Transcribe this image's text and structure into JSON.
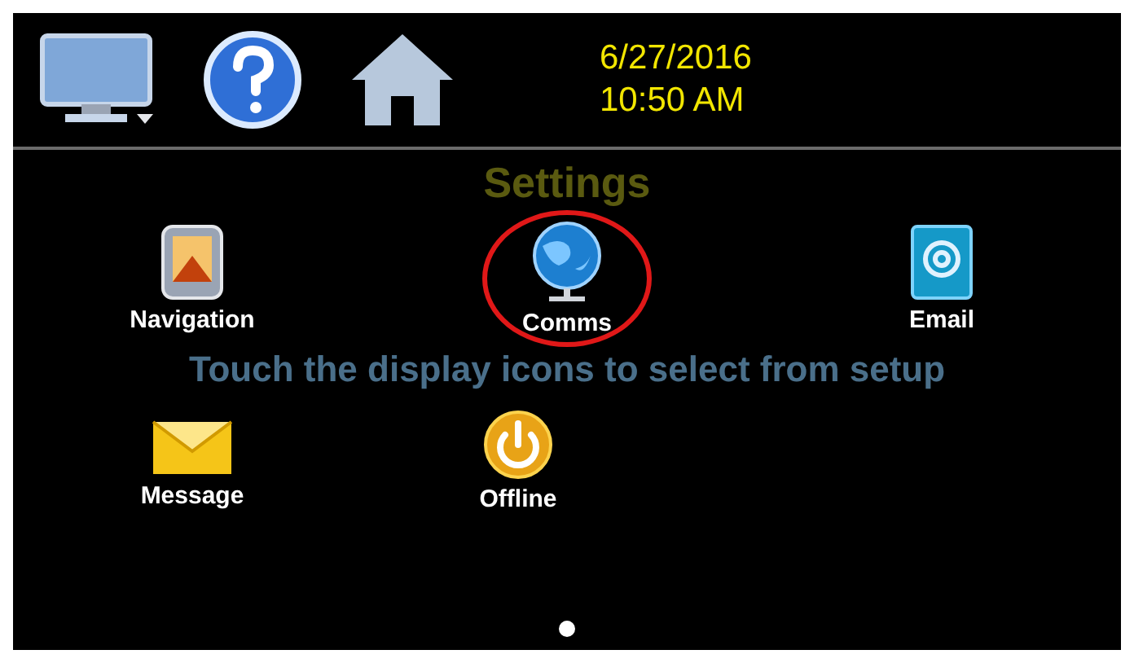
{
  "top_bar": {
    "date": "6/27/2016",
    "time": "10:50 AM"
  },
  "title": "Settings",
  "instruction": "Touch the display icons to select from setup",
  "rows": [
    [
      {
        "kind": "navigation",
        "label": "Navigation",
        "circled": false
      },
      {
        "kind": "comms",
        "label": "Comms",
        "circled": true
      },
      {
        "kind": "email",
        "label": "Email",
        "circled": false
      }
    ],
    [
      {
        "kind": "message",
        "label": "Message",
        "circled": false
      },
      {
        "kind": "offline",
        "label": "Offline",
        "circled": false
      }
    ]
  ],
  "pages": [
    {
      "selected": true
    }
  ]
}
